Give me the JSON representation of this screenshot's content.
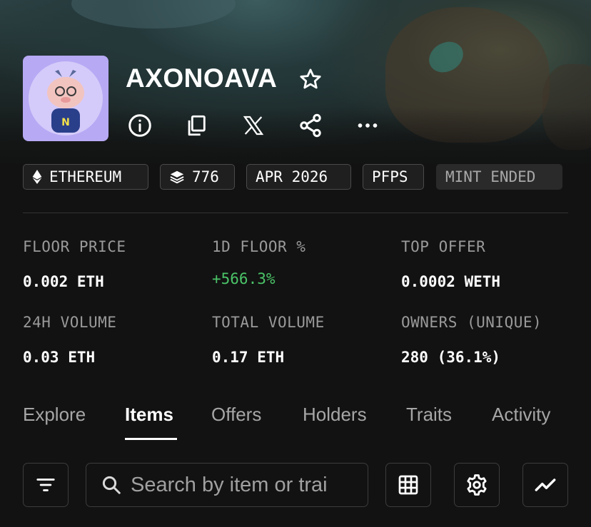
{
  "collection": {
    "name": "AXONOAVA",
    "avatar_letter": "N"
  },
  "tags": {
    "chain": "ETHEREUM",
    "items": "776",
    "date": "APR 2026",
    "category": "PFPS",
    "status": "MINT ENDED"
  },
  "stats": {
    "floor_price_label": "FLOOR PRICE",
    "floor_price_value": "0.002 ETH",
    "floor_change_label": "1D FLOOR %",
    "floor_change_value": "+566.3%",
    "top_offer_label": "TOP OFFER",
    "top_offer_value": "0.0002 WETH",
    "volume_24h_label": "24H VOLUME",
    "volume_24h_value": "0.03 ETH",
    "total_volume_label": "TOTAL VOLUME",
    "total_volume_value": "0.17 ETH",
    "owners_label": "OWNERS (UNIQUE)",
    "owners_value": "280 (36.1%)"
  },
  "tabs": [
    "Explore",
    "Items",
    "Offers",
    "Holders",
    "Traits",
    "Activity"
  ],
  "active_tab": "Items",
  "search": {
    "placeholder": "Search by item or trai"
  },
  "colors": {
    "background": "#121212",
    "positive": "#4bc468",
    "muted_text": "#9a9a9a",
    "avatar_bg": "#b7a9f4"
  },
  "icons": {
    "header": [
      "star-icon",
      "info-icon",
      "copy-icon",
      "x-logo-icon",
      "share-icon",
      "more-icon"
    ],
    "toolbar": [
      "filter-icon",
      "search-icon",
      "grid-icon",
      "settings-icon",
      "chart-icon"
    ]
  }
}
